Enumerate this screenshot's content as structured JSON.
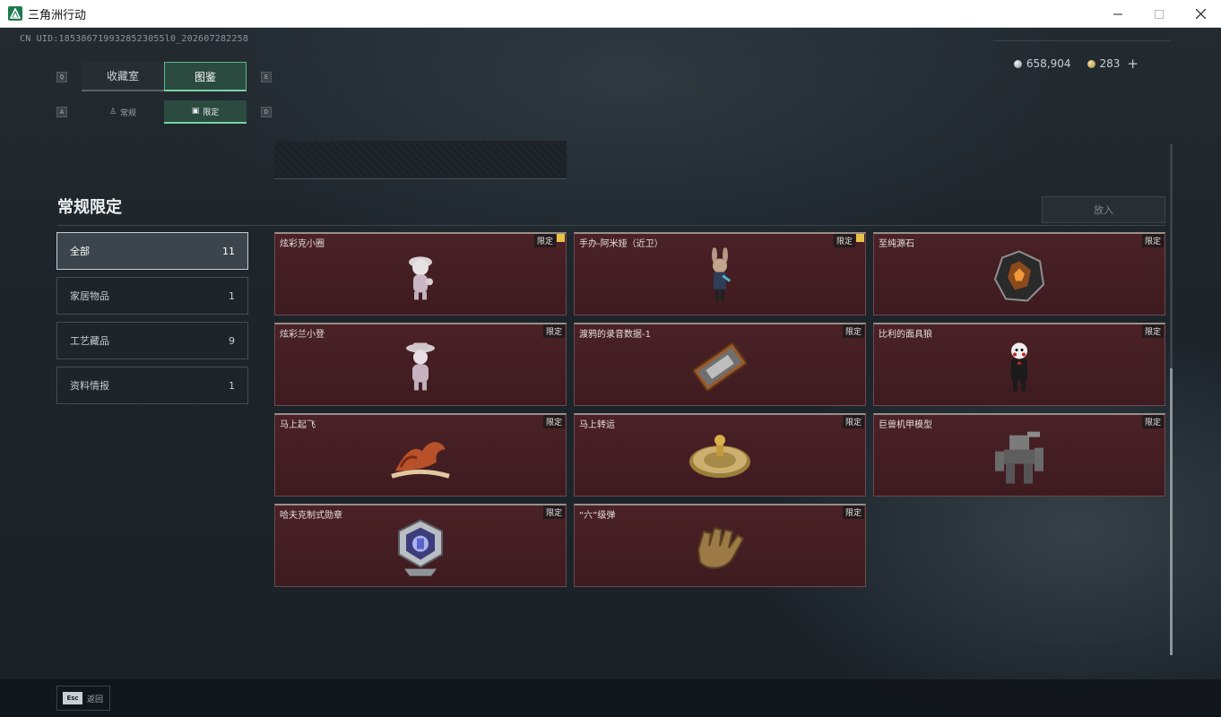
{
  "window": {
    "title": "三角洲行动"
  },
  "header": {
    "uid": "CN UID:1853867199328523055l0_202607282258",
    "currency": [
      {
        "icon": "silver-coin-icon",
        "value": "658,904"
      },
      {
        "icon": "gold-coin-icon",
        "value": "283"
      }
    ],
    "add_label": "+"
  },
  "tabs_primary": {
    "key_left": "Q",
    "key_right": "E",
    "items": [
      {
        "label": "收藏室",
        "active": false
      },
      {
        "label": "图鉴",
        "active": true
      }
    ]
  },
  "tabs_secondary": {
    "key_left": "A",
    "key_right": "D",
    "items": [
      {
        "label": "常规",
        "icon": "figure-icon",
        "active": false
      },
      {
        "label": "限定",
        "icon": "picture-icon",
        "active": true
      }
    ]
  },
  "section": {
    "title": "常规限定",
    "put_button": "放入"
  },
  "categories": [
    {
      "label": "全部",
      "count": "11",
      "active": true
    },
    {
      "label": "家居物品",
      "count": "1",
      "active": false
    },
    {
      "label": "工艺藏品",
      "count": "9",
      "active": false
    },
    {
      "label": "资料情报",
      "count": "1",
      "active": false
    }
  ],
  "items": [
    {
      "name": "炫彩克小圈",
      "tag": "限定",
      "flag": true,
      "art": "figurine-white"
    },
    {
      "name": "手办-阿米娅（近卫）",
      "tag": "限定",
      "flag": true,
      "art": "figurine-bunny"
    },
    {
      "name": "至纯源石",
      "tag": "限定",
      "flag": false,
      "art": "crystal"
    },
    {
      "name": "炫彩兰小登",
      "tag": "限定",
      "flag": false,
      "art": "figurine-hat"
    },
    {
      "name": "渡鸦的录音数据-1",
      "tag": "限定",
      "flag": false,
      "art": "device"
    },
    {
      "name": "比利的面具狼",
      "tag": "限定",
      "flag": false,
      "art": "puppet"
    },
    {
      "name": "马上起飞",
      "tag": "限定",
      "flag": false,
      "art": "horse"
    },
    {
      "name": "马上转运",
      "tag": "限定",
      "flag": false,
      "art": "coin"
    },
    {
      "name": "巨兽机甲模型",
      "tag": "限定",
      "flag": false,
      "art": "mech"
    },
    {
      "name": "哈夫克制式勋章",
      "tag": "限定",
      "flag": false,
      "art": "medal"
    },
    {
      "name": "“六”级弹",
      "tag": "限定",
      "flag": false,
      "art": "glove"
    }
  ],
  "footer": {
    "esc_key": "Esc",
    "back_label": "返回"
  },
  "colors": {
    "accent": "#79d3a6",
    "card_bg": "#4a2126",
    "gold": "#e7c34a"
  }
}
